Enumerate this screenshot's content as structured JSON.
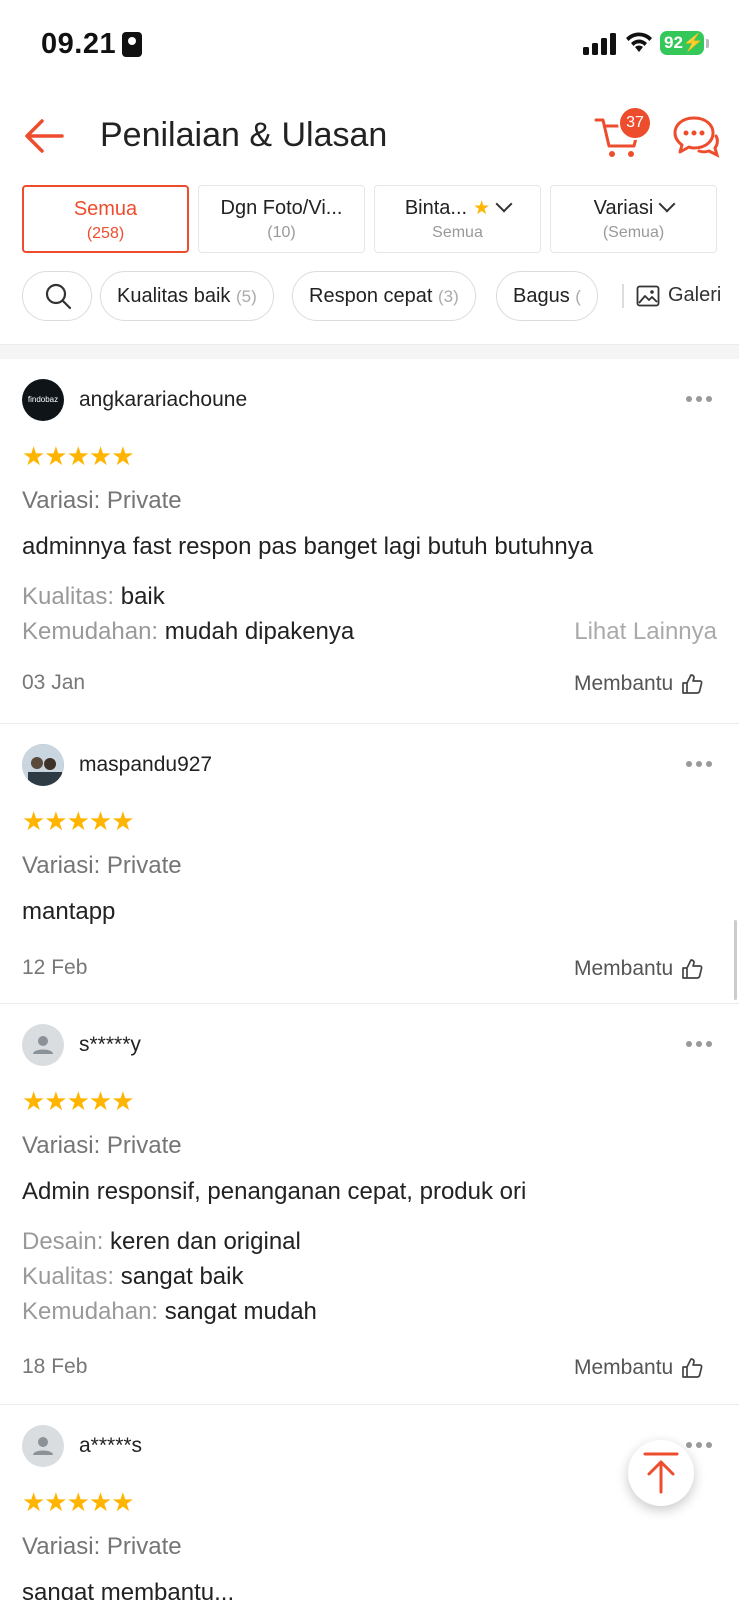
{
  "status_bar": {
    "time": "09.21",
    "battery": "92"
  },
  "header": {
    "title": "Penilaian & Ulasan",
    "cart_count": "37"
  },
  "tabs": [
    {
      "label": "Semua",
      "sub": "(258)"
    },
    {
      "label": "Dgn Foto/Vi...",
      "sub": "(10)"
    },
    {
      "label": "Binta...",
      "sub": "Semua"
    },
    {
      "label": "Variasi",
      "sub": "(Semua)"
    }
  ],
  "chips": [
    {
      "label": "Kualitas baik",
      "count": "(5)"
    },
    {
      "label": "Respon cepat",
      "count": "(3)"
    },
    {
      "label": "Bagus",
      "count": "("
    }
  ],
  "galeri_label": "Galeri",
  "helpful_label": "Membantu",
  "see_more_label": "Lihat Lainnya",
  "reviews": [
    {
      "username": "angkarariachoune",
      "avatar_text": "findobaz",
      "variasi": "Variasi: Private",
      "text": "adminnya fast respon pas banget lagi butuh butuhnya",
      "attrs": [
        {
          "k": "Kualitas:",
          "v": "baik"
        },
        {
          "k": "Kemudahan:",
          "v": "mudah dipakenya"
        }
      ],
      "date": "03 Jan"
    },
    {
      "username": "maspandu927",
      "variasi": "Variasi: Private",
      "text": "mantapp",
      "date": "12 Feb"
    },
    {
      "username": "s*****y",
      "variasi": "Variasi: Private",
      "text": "Admin responsif, penanganan cepat, produk ori",
      "attrs": [
        {
          "k": "Desain:",
          "v": "keren dan original"
        },
        {
          "k": "Kualitas:",
          "v": "sangat baik"
        },
        {
          "k": "Kemudahan:",
          "v": "sangat mudah"
        }
      ],
      "date": "18 Feb"
    },
    {
      "username": "a*****s",
      "variasi": "Variasi: Private",
      "text": "sangat membantu..."
    }
  ],
  "icons": {
    "back": "arrow-left-icon",
    "cart": "cart-icon",
    "chat": "chat-icon",
    "search": "search-icon",
    "gallery": "image-icon",
    "helpful": "thumbs-up-icon",
    "more": "more-dots-icon",
    "scroll_top": "arrow-up-icon"
  },
  "colors": {
    "accent": "#ee4d2d",
    "star": "#ffb400",
    "battery": "#34c759"
  }
}
